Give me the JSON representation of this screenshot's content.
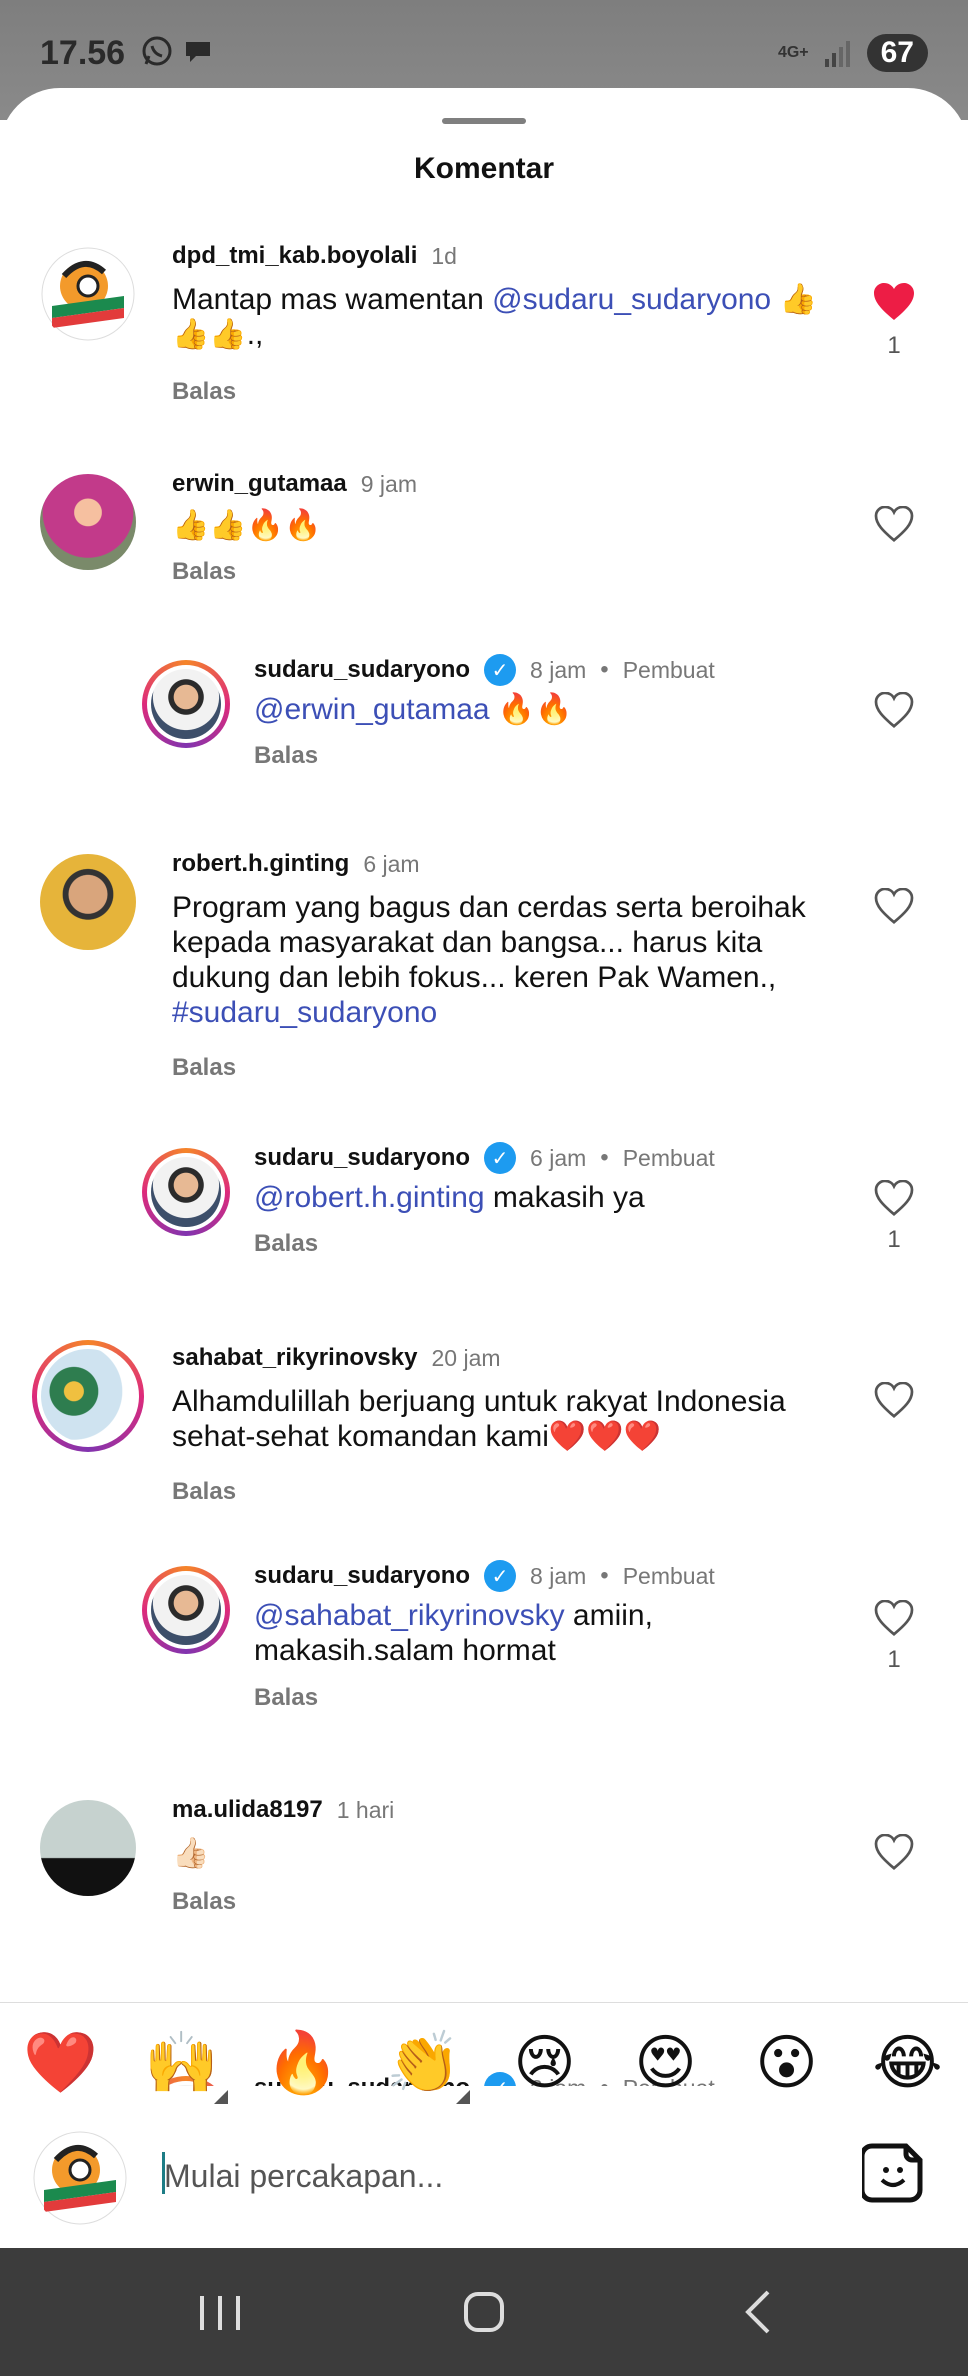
{
  "status": {
    "time": "17.56",
    "network": "4G+",
    "battery": "67"
  },
  "sheet": {
    "title": "Komentar"
  },
  "comments": [
    {
      "user": "dpd_tmi_kab.boyolali",
      "time": "1d",
      "text_plain": "Mantap mas wamentan ",
      "mention": "@sudaru_sudaryono",
      "text_after": " 👍👍👍.,",
      "reply": "Balas",
      "liked": true,
      "likes": "1"
    },
    {
      "user": "erwin_gutamaa",
      "time": "9 jam",
      "text_plain": "👍👍🔥🔥",
      "reply": "Balas"
    },
    {
      "user": "sudaru_sudaryono",
      "time": "8 jam",
      "creator": "Pembuat",
      "mention": "@erwin_gutamaa",
      "text_after": " 🔥🔥",
      "reply": "Balas"
    },
    {
      "user": "robert.h.ginting",
      "time": "6 jam",
      "text_plain": "Program yang bagus dan cerdas serta beroihak kepada masyarakat dan bangsa... harus kita dukung dan lebih fokus... keren Pak Wamen.,",
      "hashtag": "#sudaru_sudaryono",
      "reply": "Balas"
    },
    {
      "user": "sudaru_sudaryono",
      "time": "6 jam",
      "creator": "Pembuat",
      "mention": "@robert.h.ginting",
      "text_after": " makasih ya",
      "reply": "Balas",
      "likes": "1"
    },
    {
      "user": "sahabat_rikyrinovsky",
      "time": "20 jam",
      "text_plain": "Alhamdulillah berjuang untuk rakyat Indonesia sehat-sehat komandan kami❤️❤️❤️",
      "reply": "Balas"
    },
    {
      "user": "sudaru_sudaryono",
      "time": "8 jam",
      "creator": "Pembuat",
      "mention": "@sahabat_rikyrinovsky",
      "text_after": " amiin, makasih.salam hormat",
      "reply": "Balas",
      "likes": "1"
    },
    {
      "user": "ma.ulida8197",
      "time": "1 hari",
      "text_plain": "👍🏻",
      "reply": "Balas"
    },
    {
      "user": "sudaru_sudaryono",
      "time": "6 jam",
      "creator": "Pembuat"
    }
  ],
  "reactions": [
    "❤️",
    "🙌",
    "🔥",
    "👏",
    "😢",
    "😍",
    "😮",
    "😂"
  ],
  "composer": {
    "placeholder": "Mulai percakapan..."
  },
  "colors": {
    "mention": "#3c4fb6",
    "liked_heart": "#ed1d45",
    "verified": "#1d9bf0",
    "navbar": "#3c3c3c"
  }
}
